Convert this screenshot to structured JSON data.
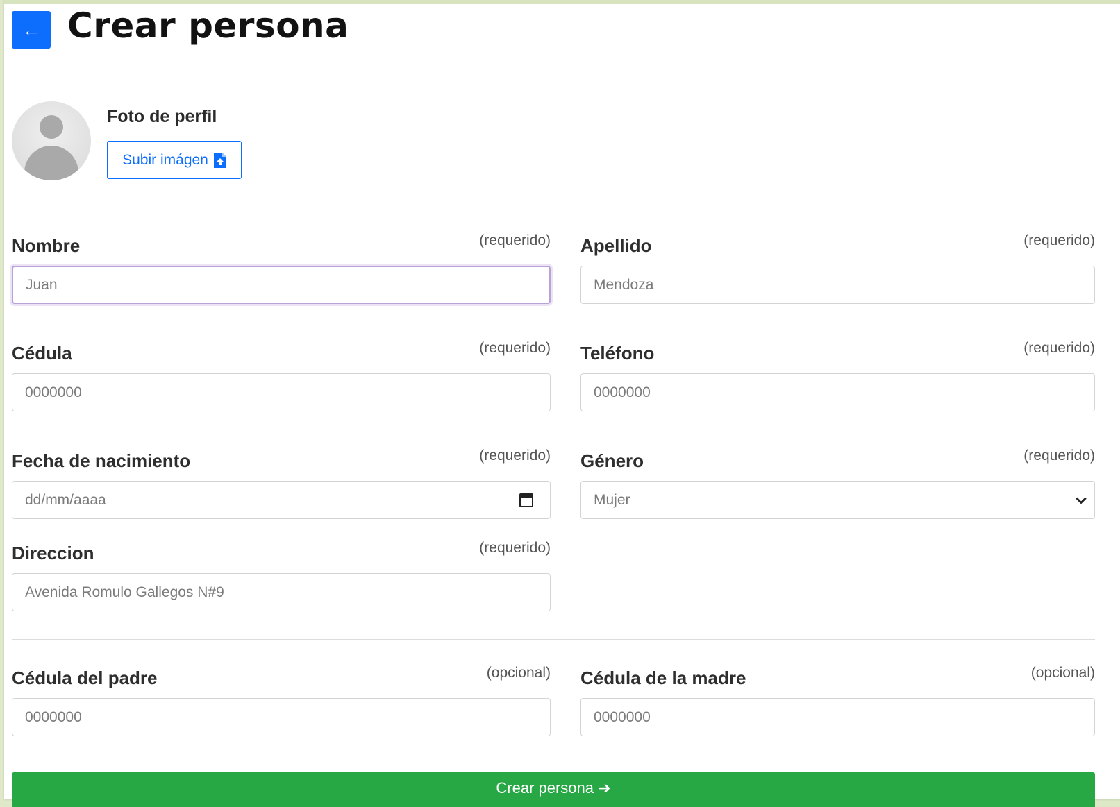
{
  "header": {
    "title": "Crear persona",
    "back_icon": "←"
  },
  "profile": {
    "label": "Foto de perfil",
    "upload_label": "Subir imágen"
  },
  "fields": {
    "nombre": {
      "label": "Nombre",
      "hint": "(requerido)",
      "placeholder": "Juan"
    },
    "apellido": {
      "label": "Apellido",
      "hint": "(requerido)",
      "placeholder": "Mendoza"
    },
    "cedula": {
      "label": "Cédula",
      "hint": "(requerido)",
      "placeholder": "0000000"
    },
    "telefono": {
      "label": "Teléfono",
      "hint": "(requerido)",
      "placeholder": "0000000"
    },
    "fecha": {
      "label": "Fecha de nacimiento",
      "hint": "(requerido)",
      "value": "dd/mm/aaaa"
    },
    "genero": {
      "label": "Género",
      "hint": "(requerido)",
      "value": "Mujer"
    },
    "direccion": {
      "label": "Direccion",
      "hint": "(requerido)",
      "placeholder": "Avenida Romulo Gallegos N#9"
    },
    "cedula_padre": {
      "label": "Cédula del padre",
      "hint": "(opcional)",
      "placeholder": "0000000"
    },
    "cedula_madre": {
      "label": "Cédula de la madre",
      "hint": "(opcional)",
      "placeholder": "0000000"
    }
  },
  "submit": {
    "label": "Crear persona",
    "arrow": "➔"
  },
  "colors": {
    "primary": "#0d6efd",
    "success": "#28a745"
  }
}
